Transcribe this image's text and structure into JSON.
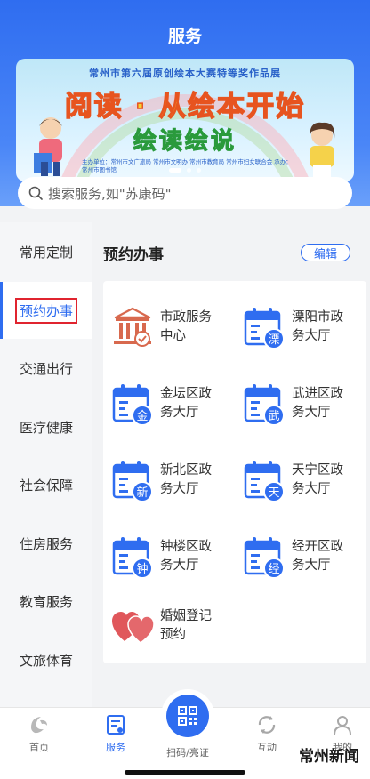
{
  "header": {
    "title": "服务"
  },
  "banner": {
    "top_text": "常州市第六届原创绘本大赛特等奖作品展",
    "main_text": "阅读 · 从绘本开始",
    "sub_text": "绘读绘说",
    "org_text": "主办单位：常州市文广旅局 常州市文明办 常州市教育局 常州市妇女联合会 承办：常州市图书馆"
  },
  "search": {
    "placeholder": "搜索服务,如\"苏康码\""
  },
  "sidebar": {
    "items": [
      {
        "label": "常用定制"
      },
      {
        "label": "预约办事"
      },
      {
        "label": "交通出行"
      },
      {
        "label": "医疗健康"
      },
      {
        "label": "社会保障"
      },
      {
        "label": "住房服务"
      },
      {
        "label": "教育服务"
      },
      {
        "label": "文旅体育"
      }
    ],
    "active_index": 1
  },
  "main": {
    "section_title": "预约办事",
    "edit_label": "编辑",
    "services": [
      {
        "label": "市政服务中心",
        "icon": "government-building-icon"
      },
      {
        "label": "溧阳市政务大厅",
        "icon": "calendar-icon",
        "badge": "溧"
      },
      {
        "label": "金坛区政务大厅",
        "icon": "calendar-icon",
        "badge": "金"
      },
      {
        "label": "武进区政务大厅",
        "icon": "calendar-icon",
        "badge": "武"
      },
      {
        "label": "新北区政务大厅",
        "icon": "calendar-icon",
        "badge": "新"
      },
      {
        "label": "天宁区政务大厅",
        "icon": "calendar-icon",
        "badge": "天"
      },
      {
        "label": "钟楼区政务大厅",
        "icon": "calendar-icon",
        "badge": "钟"
      },
      {
        "label": "经开区政务大厅",
        "icon": "calendar-icon",
        "badge": "经"
      },
      {
        "label": "婚姻登记预约",
        "icon": "hearts-icon"
      }
    ]
  },
  "bottom_nav": {
    "items": [
      {
        "label": "首页"
      },
      {
        "label": "服务"
      },
      {
        "label": "扫码/亮证"
      },
      {
        "label": "互动"
      },
      {
        "label": "我的"
      }
    ],
    "active_index": 1
  },
  "watermark": "常州新闻",
  "colors": {
    "primary": "#2f6df0",
    "highlight_border": "#e0242f",
    "heart": "#e0575b"
  }
}
